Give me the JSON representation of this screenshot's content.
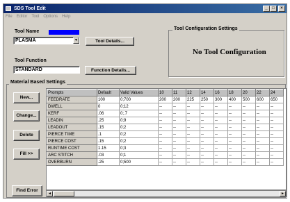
{
  "window": {
    "title": "SDS Tool Edit",
    "controls": [
      "_",
      "□",
      "×"
    ]
  },
  "menu": [
    "File",
    "Editor",
    "Tool",
    "Options",
    "Help"
  ],
  "tool_name": {
    "label": "Tool Name",
    "value": "PLASMA",
    "details_button": "Tool Details..."
  },
  "tool_function": {
    "label": "Tool Function",
    "value": "STANDARD",
    "details_button": "Function Details..."
  },
  "tool_config": {
    "title": "Tool Configuration Settings",
    "message": "No Tool Configuration"
  },
  "material": {
    "title": "Material Based Settings",
    "buttons": {
      "new": "New...",
      "change": "Change...",
      "delete": "Delete",
      "fill": "Fill >>",
      "find_error": "Find Error"
    },
    "headers": [
      "Prompts",
      "Default",
      "Valid Values",
      "10",
      "11",
      "12",
      "14",
      "16",
      "18",
      "20",
      "22",
      "24"
    ],
    "rows": [
      [
        "FEEDRATE",
        "100",
        "0;700",
        "200",
        "200",
        "225",
        "250",
        "300",
        "400",
        "500",
        "600",
        "650"
      ],
      [
        "DWELL",
        "0",
        "0;12",
        "--",
        "--",
        "--",
        "--",
        "--",
        "--",
        "--",
        "--",
        "--"
      ],
      [
        "KERF",
        ".06",
        "0;.7",
        "--",
        "--",
        "--",
        "--",
        "--",
        "--",
        "--",
        "--",
        "--"
      ],
      [
        "LEADIN",
        ".25",
        "0;9",
        "--",
        "--",
        "--",
        "--",
        "--",
        "--",
        "--",
        "--",
        "--"
      ],
      [
        "LEADOUT",
        ".15",
        "0;2",
        "--",
        "--",
        "--",
        "--",
        "--",
        "--",
        "--",
        "--",
        "--"
      ],
      [
        "PIERCE TIME",
        ".1",
        "0;2",
        "--",
        "--",
        "--",
        "--",
        "--",
        "--",
        "--",
        "--",
        "--"
      ],
      [
        "PIERCE COST",
        ".15",
        "0;2",
        "--",
        "--",
        "--",
        "--",
        "--",
        "--",
        "--",
        "--",
        "--"
      ],
      [
        "RUNTIME COST",
        "1.15",
        "0;3",
        "--",
        "--",
        "--",
        "--",
        "--",
        "--",
        "--",
        "--",
        "--"
      ],
      [
        "ARC STITCH",
        ".03",
        "0;1",
        "--",
        "--",
        "--",
        "--",
        "--",
        "--",
        "--",
        "--",
        "--"
      ],
      [
        "OVERBURN",
        ".25",
        "0;500",
        "--",
        "--",
        "--",
        "--",
        "--",
        "--",
        "--",
        "--",
        "--"
      ]
    ]
  },
  "colors": {
    "titlebar": "#0a246a",
    "tool_color_swatch": "#0000ff",
    "face": "#d4d0c8"
  }
}
